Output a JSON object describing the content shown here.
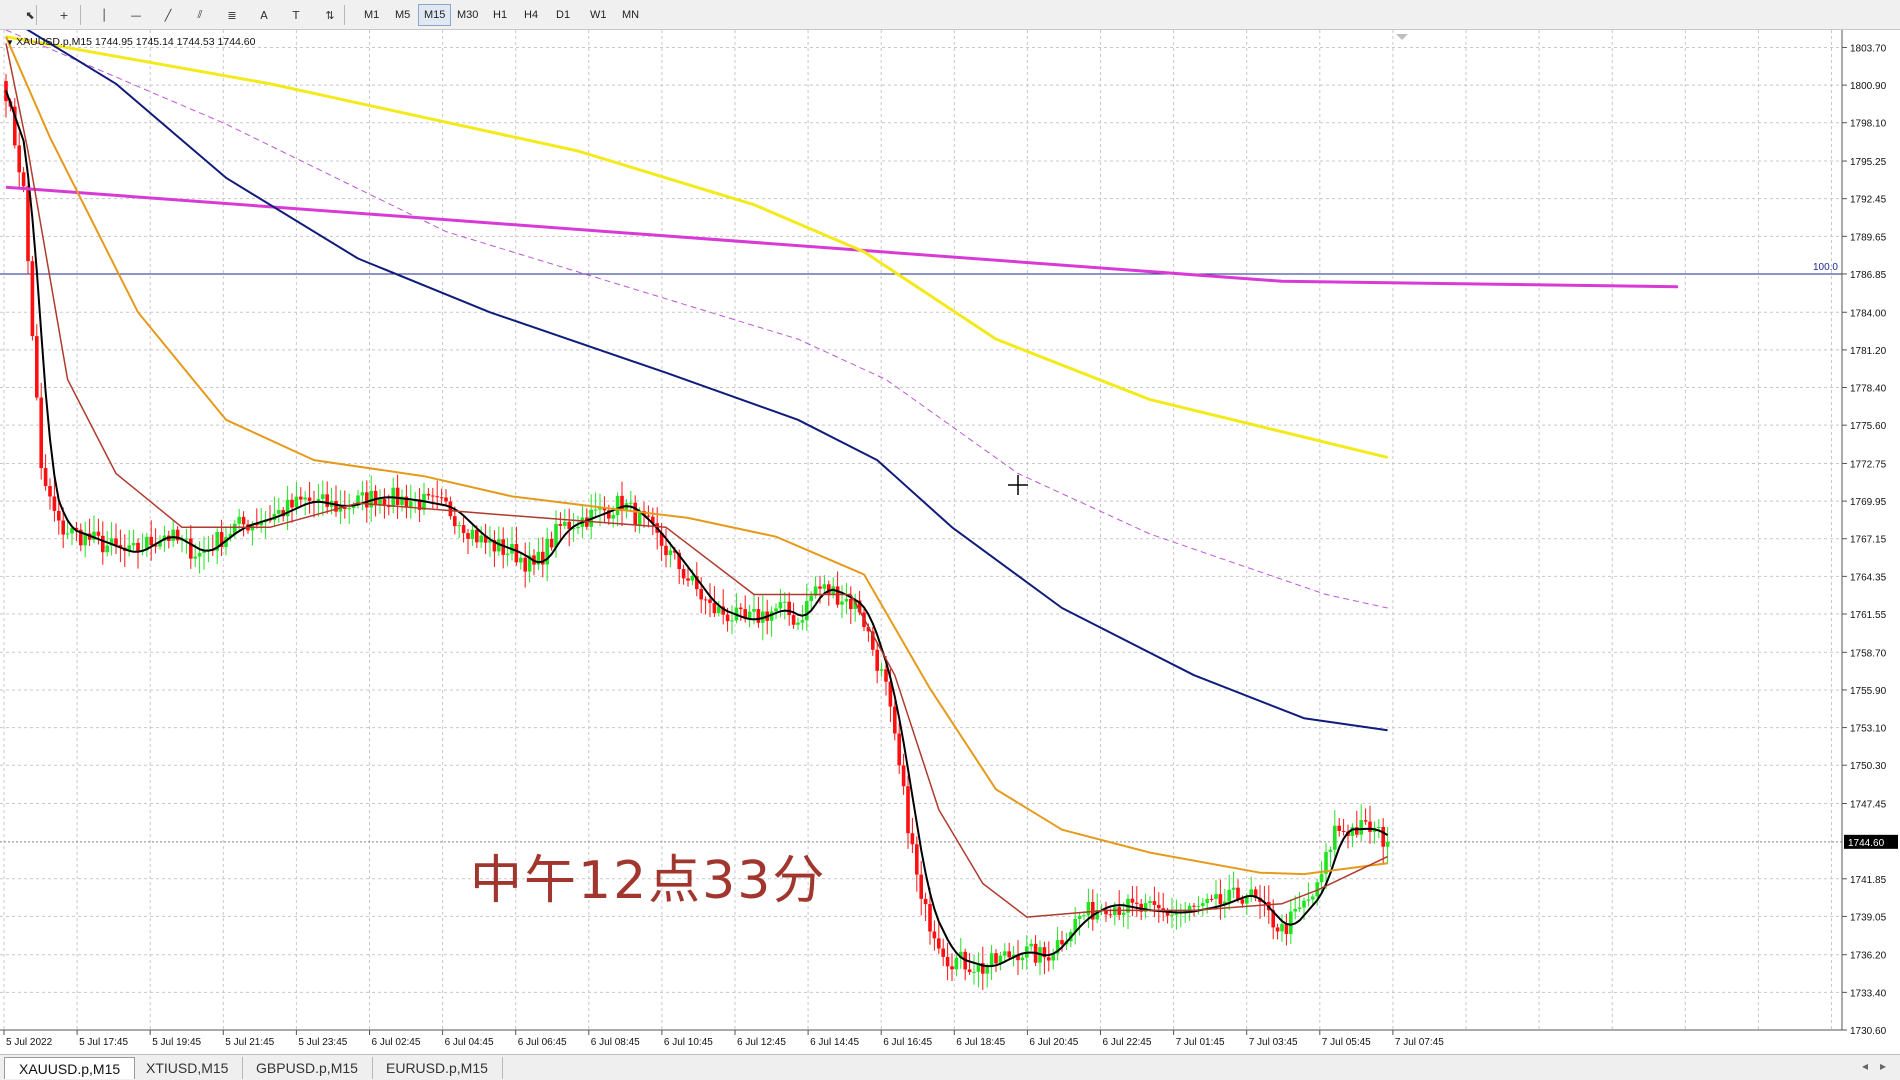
{
  "toolbar": {
    "tools": [
      {
        "name": "cursor-tool-icon",
        "glyph": "⬉"
      },
      {
        "name": "crosshair-tool-icon",
        "glyph": "+"
      },
      {
        "name": "vertical-line-tool-icon",
        "glyph": "│"
      },
      {
        "name": "horizontal-line-tool-icon",
        "glyph": "—"
      },
      {
        "name": "trendline-tool-icon",
        "glyph": "╱"
      },
      {
        "name": "channel-tool-icon",
        "glyph": "⫽"
      },
      {
        "name": "fibonacci-tool-icon",
        "glyph": "≣"
      },
      {
        "name": "text-tool-icon",
        "glyph": "A"
      },
      {
        "name": "text-label-tool-icon",
        "glyph": "T"
      },
      {
        "name": "arrows-tool-icon",
        "glyph": "⇅"
      }
    ],
    "timeframes": [
      "M1",
      "M5",
      "M15",
      "M30",
      "H1",
      "H4",
      "D1",
      "W1",
      "MN"
    ],
    "active_timeframe": "M15"
  },
  "chart": {
    "symbol_label": "XAUUSD.p,M15  1744.95 1745.14 1744.53 1744.60",
    "annotation": "中午12点33分",
    "level_label": "100.0",
    "current_price": "1744.60",
    "current_price_value": 1744.6,
    "colors": {
      "bull": "#22e322",
      "bear": "#ff1010",
      "ma_black": "#000000",
      "ma_red": "#b03a2e",
      "ma_orange": "#e69a1c",
      "ma_navy": "#101c7a",
      "ma_violet_dash": "#c056d6",
      "ma_yellow": "#f2ea1a",
      "ma_magenta": "#d83ad6",
      "grid": "#c8c8c8",
      "annotation": "#a0362d"
    }
  },
  "chart_data": {
    "type": "candlestick",
    "title": "",
    "xlabel": "",
    "ylabel": "",
    "ylim": [
      1730.6,
      1805.0
    ],
    "price_labels": [
      "1803.70",
      "1800.90",
      "1798.10",
      "1795.25",
      "1792.45",
      "1789.65",
      "1786.85",
      "1784.00",
      "1781.20",
      "1778.40",
      "1775.60",
      "1772.75",
      "1769.95",
      "1767.15",
      "1764.35",
      "1761.55",
      "1758.70",
      "1755.90",
      "1753.10",
      "1750.30",
      "1747.45",
      "1741.85",
      "1739.05",
      "1736.20",
      "1733.40",
      "1730.60"
    ],
    "time_labels": [
      "5 Jul 2022",
      "5 Jul 17:45",
      "5 Jul 19:45",
      "5 Jul 21:45",
      "5 Jul 23:45",
      "6 Jul 02:45",
      "6 Jul 04:45",
      "6 Jul 06:45",
      "6 Jul 08:45",
      "6 Jul 10:45",
      "6 Jul 12:45",
      "6 Jul 14:45",
      "6 Jul 16:45",
      "6 Jul 18:45",
      "6 Jul 20:45",
      "6 Jul 22:45",
      "7 Jul 01:45",
      "7 Jul 03:45",
      "7 Jul 05:45",
      "7 Jul 07:45"
    ],
    "horizontal_level": 1786.85,
    "close_anchors": [
      [
        0,
        1800.5
      ],
      [
        4,
        1793
      ],
      [
        8,
        1772
      ],
      [
        12,
        1768
      ],
      [
        20,
        1767
      ],
      [
        28,
        1766
      ],
      [
        36,
        1767.5
      ],
      [
        44,
        1766
      ],
      [
        52,
        1768
      ],
      [
        60,
        1768.8
      ],
      [
        68,
        1770
      ],
      [
        76,
        1769.5
      ],
      [
        84,
        1770.3
      ],
      [
        92,
        1770
      ],
      [
        100,
        1769.5
      ],
      [
        108,
        1767
      ],
      [
        116,
        1766
      ],
      [
        120,
        1765
      ],
      [
        126,
        1768
      ],
      [
        134,
        1769
      ],
      [
        140,
        1769.8
      ],
      [
        146,
        1768
      ],
      [
        152,
        1765.5
      ],
      [
        160,
        1762
      ],
      [
        168,
        1761
      ],
      [
        176,
        1762
      ],
      [
        180,
        1761
      ],
      [
        184,
        1763.5
      ],
      [
        188,
        1763.2
      ],
      [
        194,
        1762
      ],
      [
        200,
        1756
      ],
      [
        204,
        1748
      ],
      [
        208,
        1740
      ],
      [
        214,
        1736
      ],
      [
        222,
        1735.2
      ],
      [
        230,
        1736.5
      ],
      [
        236,
        1736
      ],
      [
        244,
        1739
      ],
      [
        250,
        1740
      ],
      [
        258,
        1739.5
      ],
      [
        266,
        1739.3
      ],
      [
        274,
        1739.8
      ],
      [
        282,
        1740.8
      ],
      [
        290,
        1738
      ],
      [
        298,
        1741
      ],
      [
        302,
        1745.5
      ],
      [
        310,
        1745.6
      ],
      [
        314,
        1744.6
      ]
    ],
    "ma_series": [
      {
        "key": "ma_magenta",
        "width": 3,
        "dash": "",
        "points": [
          [
            0,
            1793.3
          ],
          [
            290,
            1786.3
          ],
          [
            380,
            1785.9
          ]
        ]
      },
      {
        "key": "ma_yellow",
        "width": 3,
        "dash": "",
        "points": [
          [
            0,
            1804.5
          ],
          [
            60,
            1801
          ],
          [
            130,
            1796
          ],
          [
            170,
            1792
          ],
          [
            195,
            1788.5
          ],
          [
            225,
            1782
          ],
          [
            260,
            1777.5
          ],
          [
            314,
            1773.2
          ]
        ]
      },
      {
        "key": "ma_violet_dash",
        "width": 1,
        "dash": "6,4",
        "points": [
          [
            0,
            1805
          ],
          [
            50,
            1798
          ],
          [
            100,
            1790
          ],
          [
            150,
            1785
          ],
          [
            180,
            1782
          ],
          [
            200,
            1779
          ],
          [
            230,
            1772
          ],
          [
            260,
            1767.5
          ],
          [
            300,
            1763
          ],
          [
            314,
            1762
          ]
        ]
      },
      {
        "key": "ma_navy",
        "width": 2,
        "dash": "",
        "points": [
          [
            0,
            1806
          ],
          [
            25,
            1801
          ],
          [
            50,
            1794
          ],
          [
            80,
            1788
          ],
          [
            110,
            1784
          ],
          [
            150,
            1779.5
          ],
          [
            180,
            1776
          ],
          [
            198,
            1773
          ],
          [
            215,
            1768
          ],
          [
            240,
            1762
          ],
          [
            270,
            1757
          ],
          [
            295,
            1753.8
          ],
          [
            314,
            1752.9
          ]
        ]
      },
      {
        "key": "ma_orange",
        "width": 2,
        "dash": "",
        "points": [
          [
            0,
            1804.5
          ],
          [
            10,
            1797
          ],
          [
            30,
            1784
          ],
          [
            50,
            1776
          ],
          [
            70,
            1773
          ],
          [
            95,
            1771.8
          ],
          [
            115,
            1770.3
          ],
          [
            135,
            1769.5
          ],
          [
            155,
            1768.7
          ],
          [
            175,
            1767.3
          ],
          [
            195,
            1764.5
          ],
          [
            210,
            1756
          ],
          [
            225,
            1748.5
          ],
          [
            240,
            1745.5
          ],
          [
            260,
            1743.8
          ],
          [
            285,
            1742.3
          ],
          [
            295,
            1742.2
          ],
          [
            314,
            1743
          ]
        ]
      },
      {
        "key": "ma_red",
        "width": 1.5,
        "dash": "",
        "points": [
          [
            0,
            1804
          ],
          [
            5,
            1796
          ],
          [
            14,
            1779
          ],
          [
            25,
            1772
          ],
          [
            40,
            1768
          ],
          [
            60,
            1768
          ],
          [
            80,
            1769.8
          ],
          [
            110,
            1769
          ],
          [
            130,
            1768.5
          ],
          [
            150,
            1768
          ],
          [
            170,
            1763
          ],
          [
            192,
            1763
          ],
          [
            202,
            1757
          ],
          [
            212,
            1747
          ],
          [
            222,
            1741.5
          ],
          [
            232,
            1739
          ],
          [
            250,
            1739.5
          ],
          [
            270,
            1739.5
          ],
          [
            290,
            1740
          ],
          [
            298,
            1741
          ],
          [
            314,
            1743.5
          ]
        ]
      }
    ]
  },
  "tabs": [
    {
      "label": "XAUUSD.p,M15",
      "active": true
    },
    {
      "label": "XTIUSD,M15",
      "active": false
    },
    {
      "label": "GBPUSD.p,M15",
      "active": false
    },
    {
      "label": "EURUSD.p,M15",
      "active": false
    }
  ]
}
